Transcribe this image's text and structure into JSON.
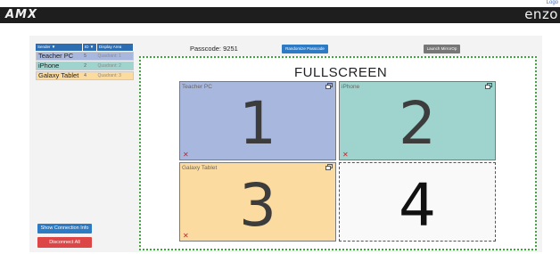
{
  "header": {
    "logout_label": "Logo",
    "brand_left": "AMX",
    "brand_right": "enzo"
  },
  "user_table": {
    "headers": [
      "Sender ▼",
      "ID ▼",
      "Display Area"
    ],
    "rows": [
      {
        "name": "Teacher PC",
        "id": "5",
        "area": "Quadrant: 1",
        "color": "#a8b7de"
      },
      {
        "name": "iPhone",
        "id": "2",
        "area": "Quadrant: 2",
        "color": "#9fd3cd"
      },
      {
        "name": "Galaxy Tablet",
        "id": "4",
        "area": "Quadrant: 3",
        "color": "#fcdba0"
      }
    ]
  },
  "controls": {
    "passcode_text": "Passcode: 9251",
    "randomize_label": "Randomize Passcode",
    "launch_label": "Launch MirrorOp",
    "show_connection_label": "Show Connection Info",
    "disconnect_label": "Disconnect All"
  },
  "stage": {
    "title": "FULLSCREEN",
    "quadrants": [
      {
        "label": "Teacher PC",
        "number": "1",
        "color": "#a8b7de",
        "close_icon": "✕"
      },
      {
        "label": "iPhone",
        "number": "2",
        "color": "#9fd3cd",
        "close_icon": "✕"
      },
      {
        "label": "Galaxy Tablet",
        "number": "3",
        "color": "#fcdba0",
        "close_icon": "✕"
      },
      {
        "label": "",
        "number": "4",
        "color": "#f9f9f9"
      }
    ]
  },
  "colors": {
    "accent_blue": "#2d7bc4",
    "danger_red": "#dd4646",
    "stage_border": "#3aaa3a"
  }
}
